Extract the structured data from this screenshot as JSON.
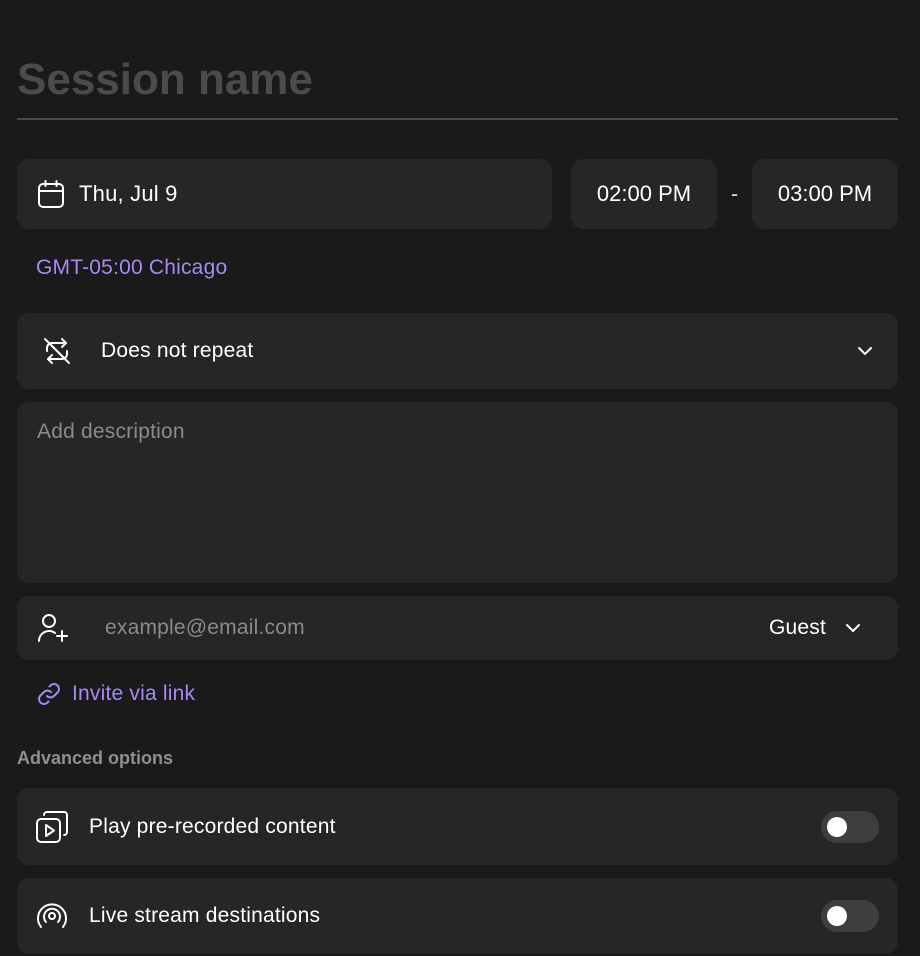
{
  "session": {
    "name_placeholder": "Session name",
    "name_value": ""
  },
  "schedule": {
    "date": "Thu, Jul 9",
    "start_time": "02:00 PM",
    "separator": "-",
    "end_time": "03:00 PM",
    "timezone": "GMT-05:00 Chicago"
  },
  "repeat": {
    "selected": "Does not repeat"
  },
  "description": {
    "placeholder": "Add description",
    "value": ""
  },
  "invite": {
    "email_placeholder": "example@email.com",
    "email_value": "",
    "role": "Guest",
    "link_label": "Invite via link"
  },
  "advanced": {
    "heading": "Advanced options",
    "options": [
      {
        "label": "Play pre-recorded content",
        "enabled": false
      },
      {
        "label": "Live stream destinations",
        "enabled": false
      }
    ]
  },
  "colors": {
    "background": "#1a1a1b",
    "card": "#262627",
    "accent": "#a689f5",
    "muted_text": "#8a8a8d"
  },
  "icons": {
    "date": "calendar-icon",
    "repeat": "repeat-off-icon",
    "repeat_dropdown": "chevron-down-icon",
    "guest": "user-add-icon",
    "role_dropdown": "chevron-down-icon",
    "invite_link": "link-icon",
    "prerecorded": "play-stack-icon",
    "livestream": "broadcast-icon"
  }
}
